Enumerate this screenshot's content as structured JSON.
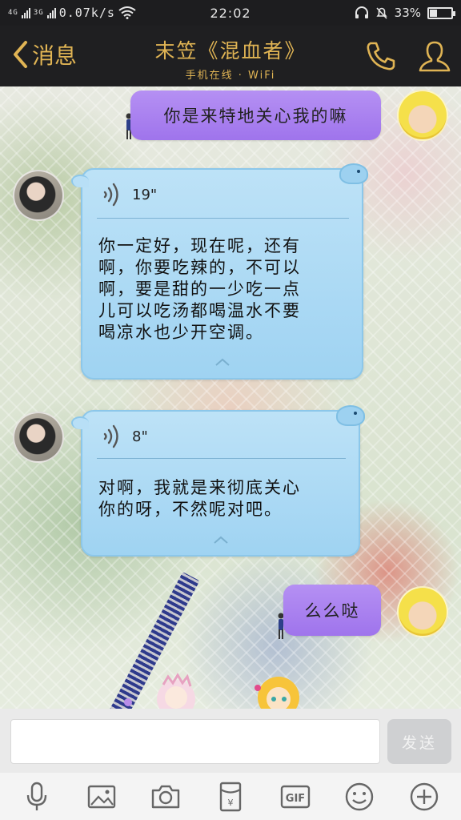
{
  "status_bar": {
    "network_speed": "0.07k/s",
    "network_type_1": "4G",
    "network_type_2": "3G",
    "time": "22:02",
    "battery_percent": "33%",
    "battery_level": 0.33
  },
  "header": {
    "back_label": "消息",
    "title": "末笠《混血者》",
    "subtitle": "手机在线 · WiFi"
  },
  "messages": [
    {
      "type": "sent",
      "text": "你是来特地关心我的嘛"
    },
    {
      "type": "voice",
      "duration": "19\"",
      "transcript": [
        "你一定好，现在呢，还有",
        "啊，你要吃辣的，不可以",
        "啊，要是甜的一少吃一点",
        "儿可以吃汤都喝温水不要",
        "喝凉水也少开空调。"
      ]
    },
    {
      "type": "voice",
      "duration": "8\"",
      "transcript": [
        "对啊，我就是来彻底关心",
        "你的呀，不然呢对吧。"
      ]
    },
    {
      "type": "sent",
      "text": "么么哒"
    }
  ],
  "input": {
    "value": "",
    "placeholder": "",
    "send_label": "发送"
  },
  "toolbar": {
    "items": [
      "mic-icon",
      "image-icon",
      "camera-icon",
      "red-packet-icon",
      "gif-icon",
      "emoji-icon",
      "plus-icon"
    ],
    "gif_label": "GIF"
  },
  "colors": {
    "header_accent": "#e0b454",
    "sent_bubble": "#a97ff0",
    "received_bubble": "#a9d9f4"
  }
}
